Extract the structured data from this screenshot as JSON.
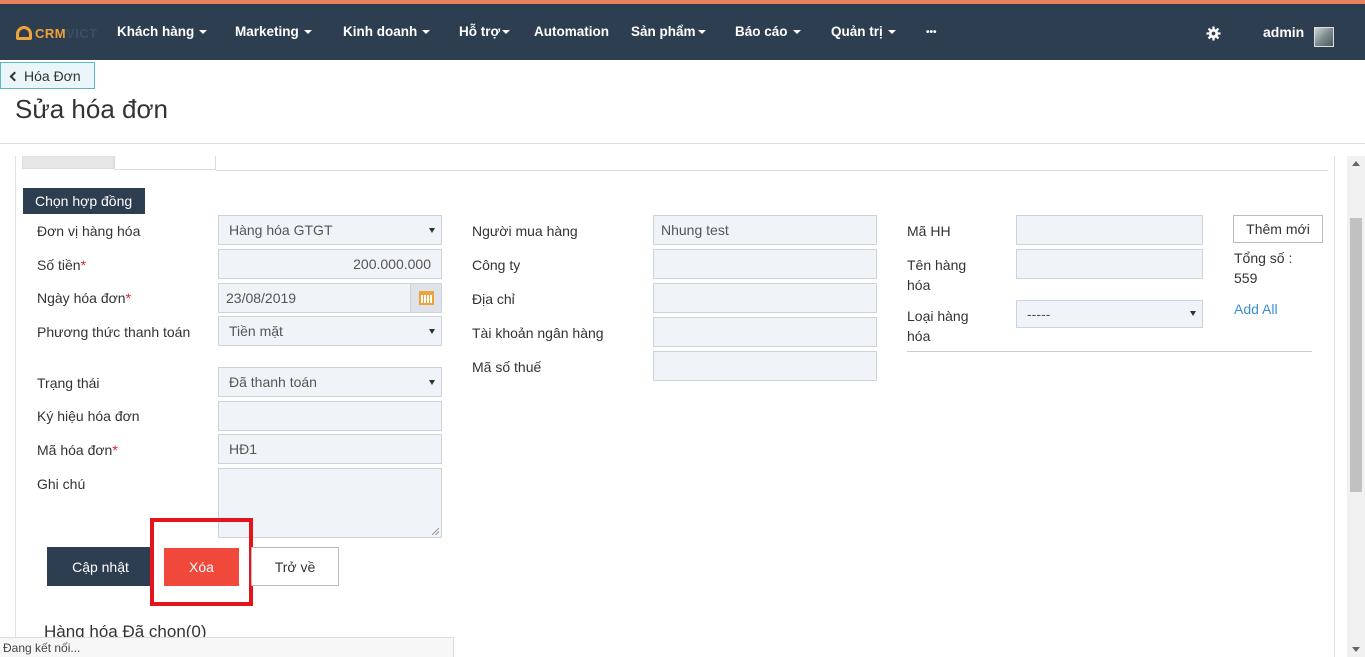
{
  "brand": {
    "prefix": "CRM",
    "suffix": "VICT",
    "accent": "#f0a23a"
  },
  "nav": {
    "items": [
      {
        "label": "Khách hàng"
      },
      {
        "label": "Marketing"
      },
      {
        "label": "Kinh doanh"
      },
      {
        "label": "Hỗ trợ"
      },
      {
        "label": "Automation"
      },
      {
        "label": "Sản phẩm"
      },
      {
        "label": "Báo cáo"
      },
      {
        "label": "Quản trị"
      },
      {
        "label": "•••"
      }
    ],
    "user": "admin"
  },
  "breadcrumb": {
    "back_label": "Hóa Đơn"
  },
  "page": {
    "title": "Sửa hóa đơn"
  },
  "form": {
    "choose_contract": "Chọn hợp đồng",
    "left": [
      {
        "label": "Đơn vị hàng hóa",
        "value": "Hàng hóa GTGT"
      },
      {
        "label": "Số tiền",
        "value": "200.000.000",
        "required": "*"
      },
      {
        "label": "Ngày hóa đơn",
        "value": "23/08/2019",
        "required": "*"
      },
      {
        "label": "Phương thức thanh toán",
        "value": "Tiền mặt"
      },
      {
        "label": "Trạng thái",
        "value": "Đã thanh toán"
      },
      {
        "label": "Ký hiệu hóa đơn",
        "value": ""
      },
      {
        "label": "Mã hóa đơn",
        "value": "HĐ1",
        "required": "*"
      },
      {
        "label": "Ghi chú",
        "value": ""
      }
    ],
    "middle": [
      {
        "label": "Người mua hàng",
        "value": "Nhung test"
      },
      {
        "label": "Công ty",
        "value": ""
      },
      {
        "label": "Địa chỉ",
        "value": ""
      },
      {
        "label": "Tài khoản ngân hàng",
        "value": ""
      },
      {
        "label": "Mã số thuế",
        "value": ""
      }
    ],
    "right": [
      {
        "label": "Mã HH",
        "value": ""
      },
      {
        "label": "Tên hàng hóa",
        "value": ""
      },
      {
        "label": "Loại hàng hóa",
        "value": "-----"
      }
    ],
    "add_new": "Thêm mới",
    "total_label": "Tổng số :",
    "total_value": "559",
    "add_all": "Add All"
  },
  "actions": {
    "update": "Cập nhật",
    "delete": "Xóa",
    "back": "Trở về"
  },
  "selected_section": "Hàng hóa Đã chọn(0)",
  "status_bar": "Đang kết nối..."
}
